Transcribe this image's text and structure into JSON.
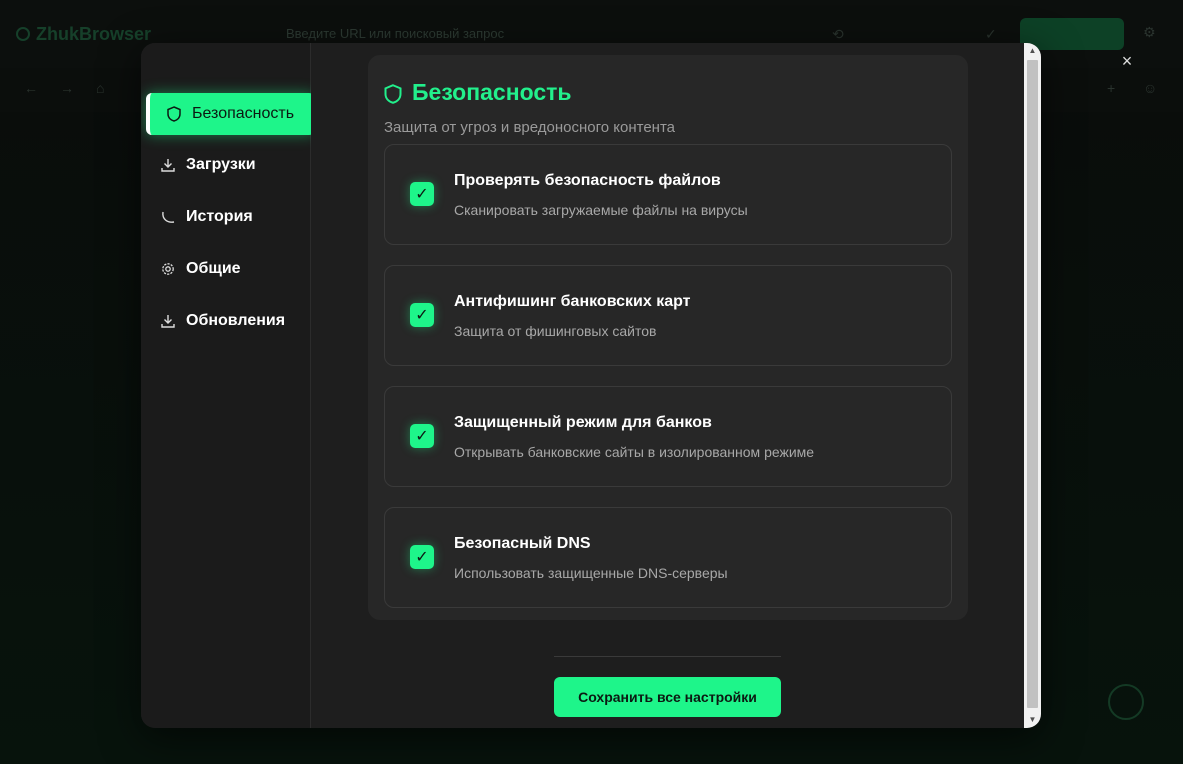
{
  "background": {
    "app_name": "ZhukBrowser",
    "url_placeholder": "Введите URL или поисковый запрос"
  },
  "sidebar": {
    "items": [
      {
        "label": "Безопасность",
        "icon": "shield-icon",
        "active": true
      },
      {
        "label": "Загрузки",
        "icon": "download-icon",
        "active": false
      },
      {
        "label": "История",
        "icon": "history-icon",
        "active": false
      },
      {
        "label": "Общие",
        "icon": "gear-icon",
        "active": false
      },
      {
        "label": "Обновления",
        "icon": "download-icon",
        "active": false
      }
    ]
  },
  "section": {
    "title": "Безопасность",
    "subtitle": "Защита от угроз и вредоносного контента",
    "options": [
      {
        "title": "Проверять безопасность файлов",
        "desc": "Сканировать загружаемые файлы на вирусы",
        "checked": true
      },
      {
        "title": "Антифишинг банковских карт",
        "desc": "Защита от фишинговых сайтов",
        "checked": true
      },
      {
        "title": "Защищенный режим для банков",
        "desc": "Открывать банковские сайты в изолированном режиме",
        "checked": true
      },
      {
        "title": "Безопасный DNS",
        "desc": "Использовать защищенные DNS-серверы",
        "checked": true
      }
    ],
    "check_glyph": "✓"
  },
  "footer": {
    "save_label": "Сохранить все настройки"
  },
  "close_glyph": "×",
  "colors": {
    "accent": "#1ef58a",
    "panel": "#272727",
    "modal": "#1e1e1e"
  }
}
